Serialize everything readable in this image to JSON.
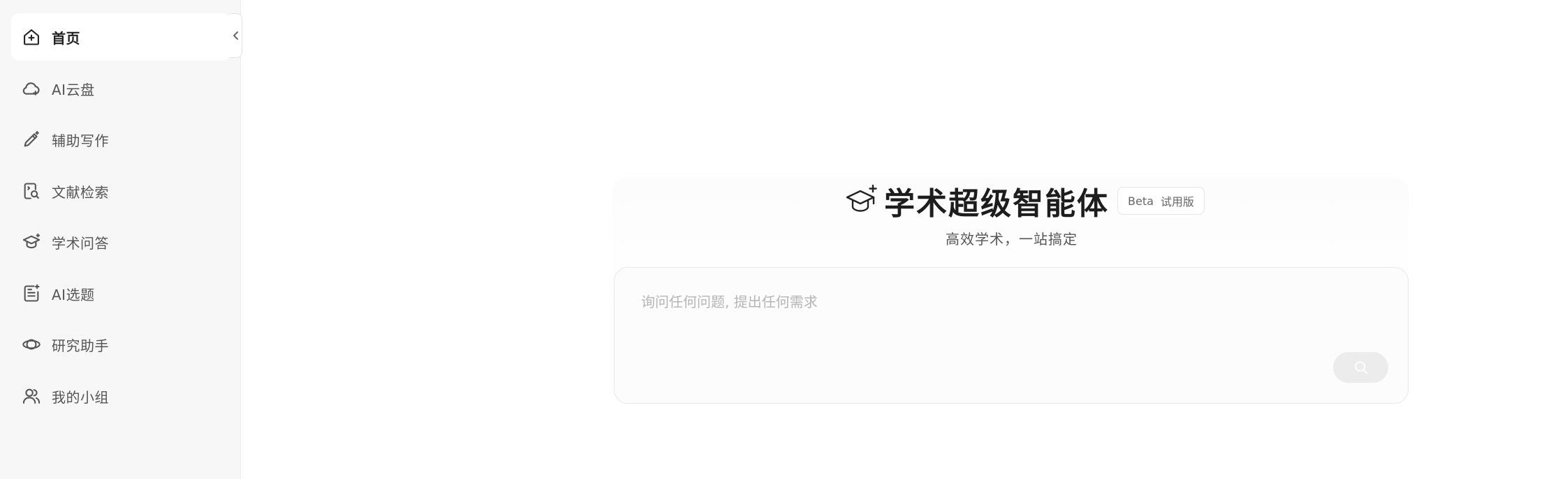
{
  "sidebar": {
    "items": [
      {
        "label": "首页",
        "icon": "home-icon",
        "active": true
      },
      {
        "label": "AI云盘",
        "icon": "cloud-icon",
        "active": false
      },
      {
        "label": "辅助写作",
        "icon": "pen-sparkle-icon",
        "active": false
      },
      {
        "label": "文献检索",
        "icon": "document-search-icon",
        "active": false
      },
      {
        "label": "学术问答",
        "icon": "graduation-cap-icon",
        "active": false
      },
      {
        "label": "AI选题",
        "icon": "note-sparkle-icon",
        "active": false
      },
      {
        "label": "研究助手",
        "icon": "planet-icon",
        "active": false
      },
      {
        "label": "我的小组",
        "icon": "users-icon",
        "active": false
      }
    ],
    "collapse_icon": "chevron-left-icon"
  },
  "hero": {
    "icon": "graduation-cap-sparkle-icon",
    "title": "学术超级智能体",
    "badge_beta": "Beta",
    "badge_trial": "试用版",
    "subtitle": "高效学术，一站搞定"
  },
  "search": {
    "placeholder": "询问任何问题, 提出任何需求",
    "value": "",
    "button_icon": "search-icon"
  },
  "colors": {
    "sidebar_bg": "#f7f7f7",
    "active_item_bg": "#ffffff",
    "search_button_bg": "#ececec"
  }
}
